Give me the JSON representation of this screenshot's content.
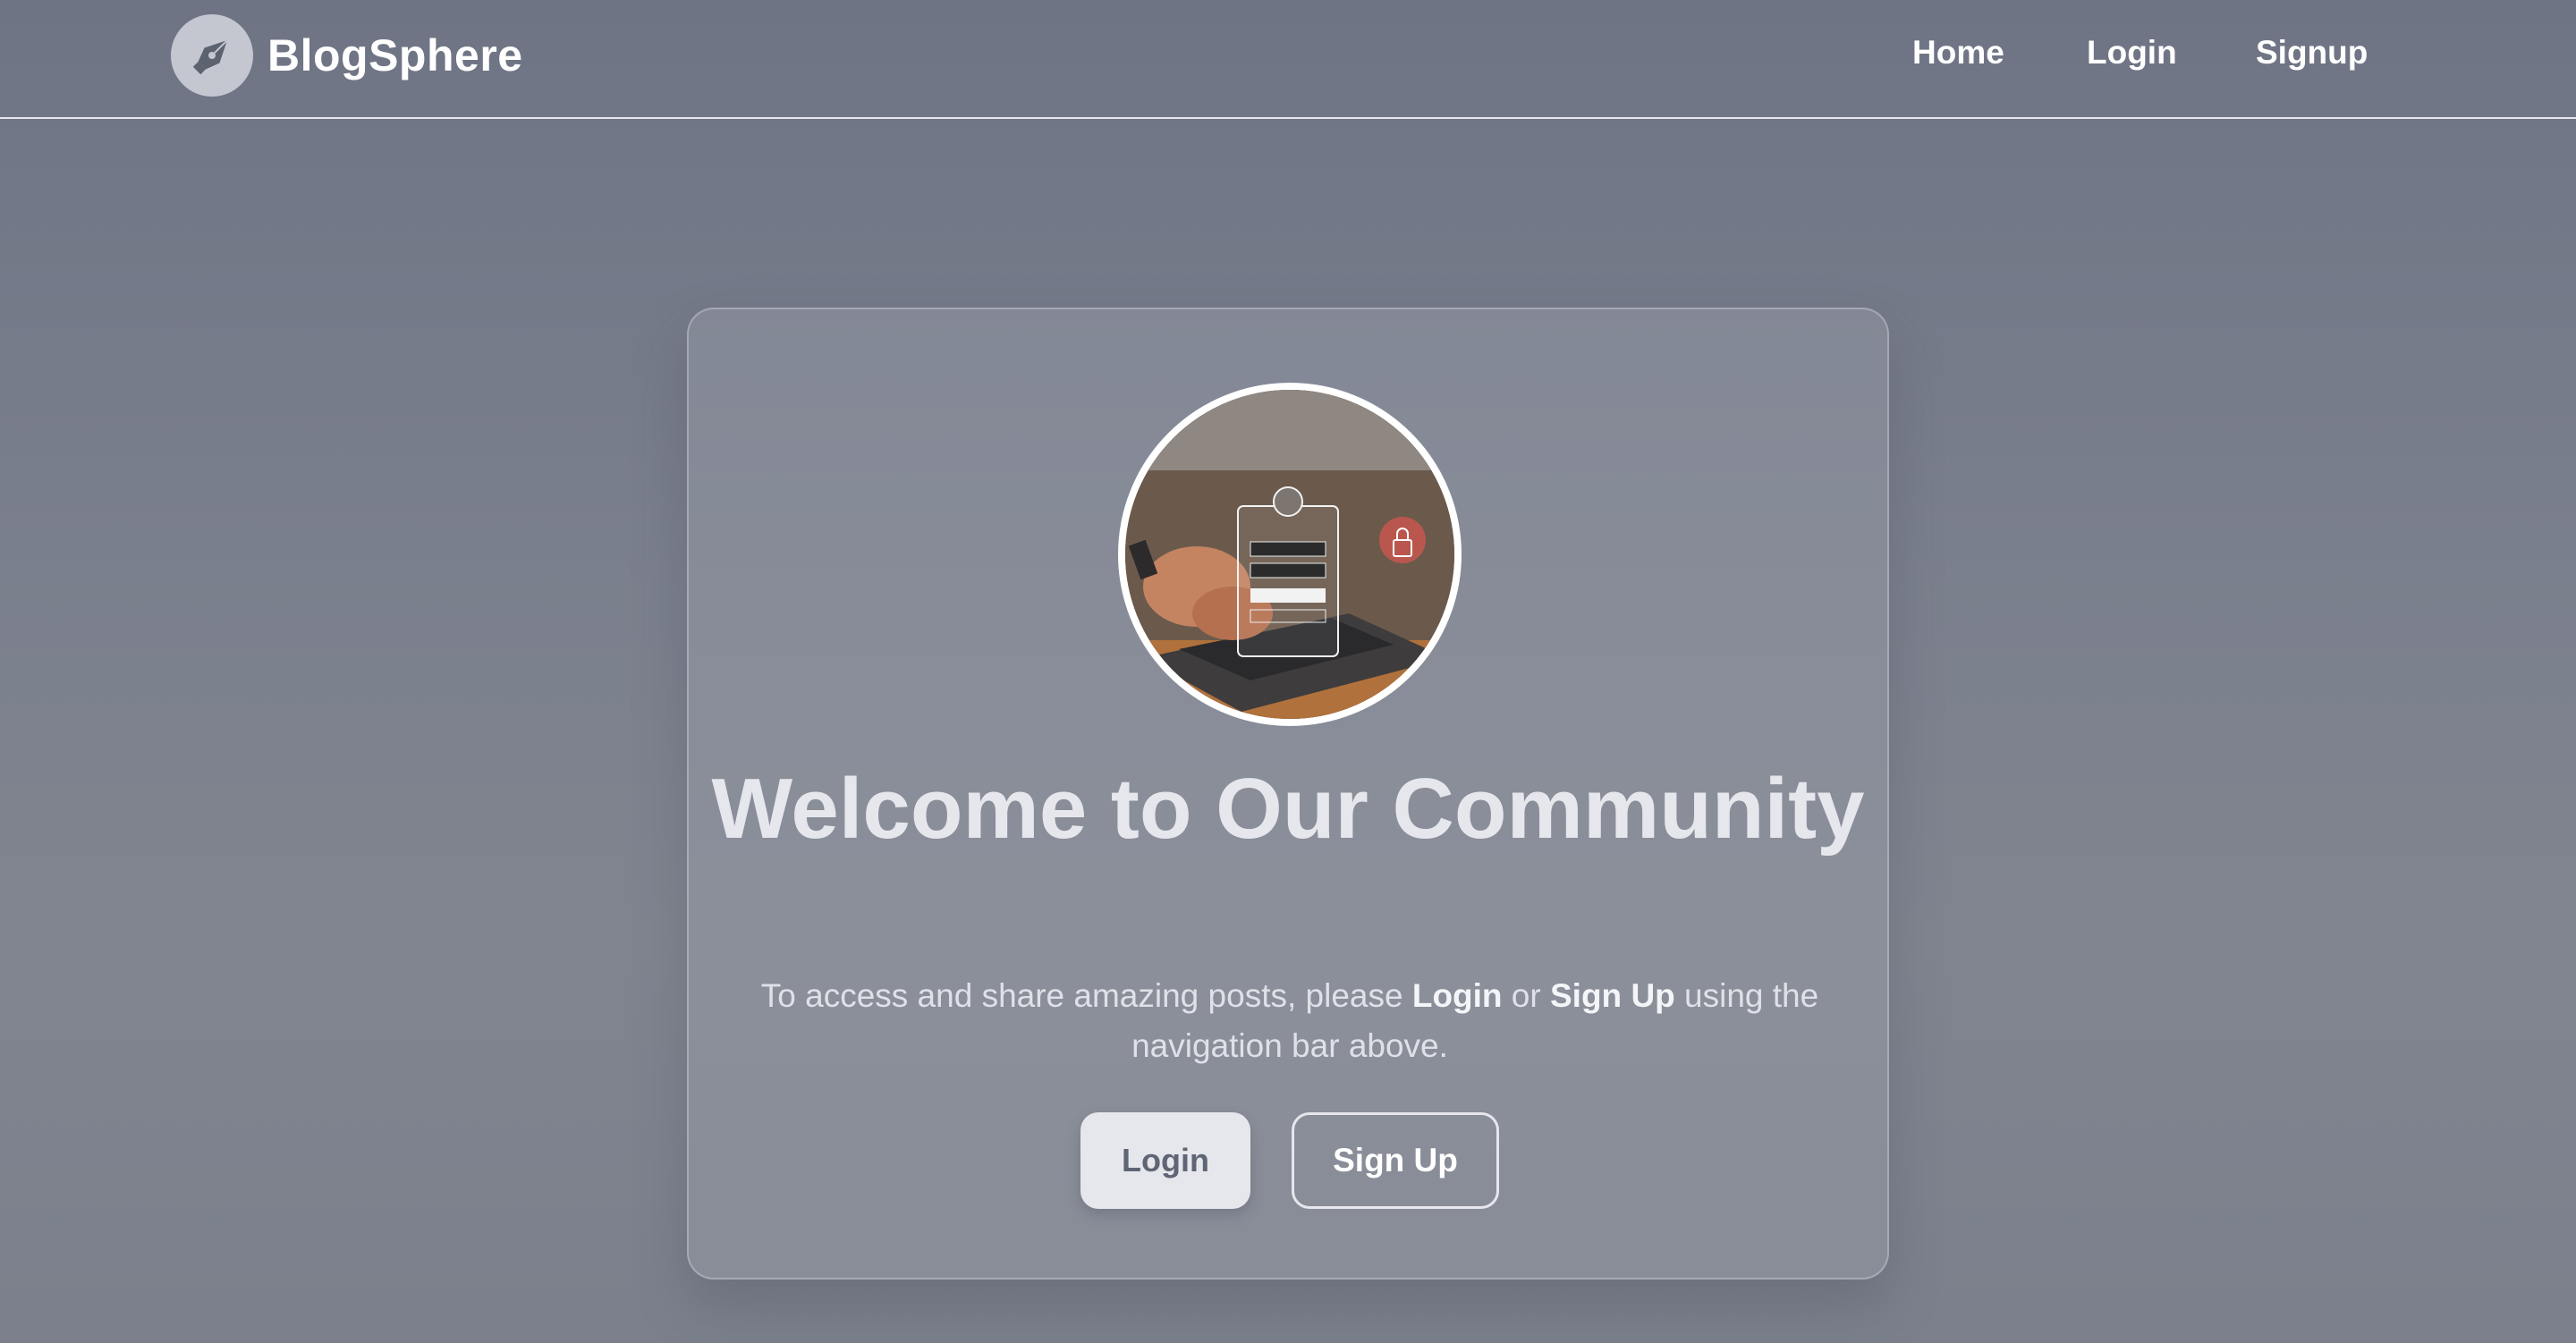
{
  "brand": {
    "name": "BlogSphere",
    "logo_icon": "pen-nib-icon"
  },
  "nav": {
    "home": "Home",
    "login": "Login",
    "signup": "Signup"
  },
  "hero": {
    "title": "Welcome to Our Community",
    "text_before": "To access and share amazing posts, please ",
    "login_word": "Login",
    "text_middle": " or ",
    "signup_word": "Sign Up",
    "text_after": " using the navigation bar above.",
    "image_alt": "Person typing on a laptop with a login screen overlay and padlock"
  },
  "buttons": {
    "login": "Login",
    "signup": "Sign Up"
  },
  "colors": {
    "background": "#767b89",
    "card": "#8a8e9a",
    "button_light": "#e6e7ec",
    "text_light": "#ffffff"
  }
}
